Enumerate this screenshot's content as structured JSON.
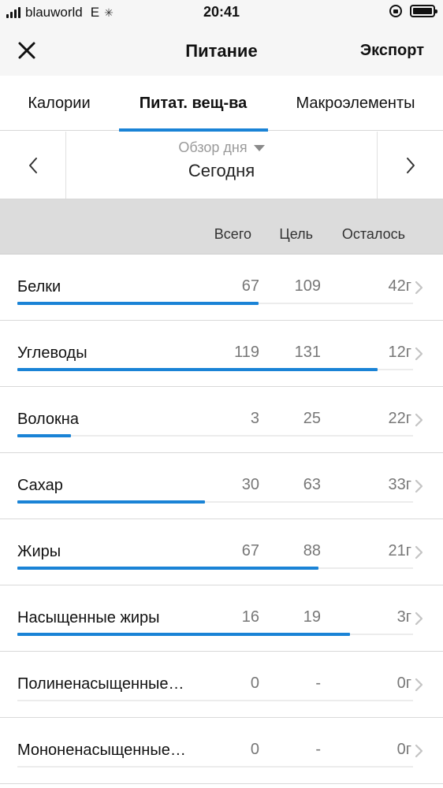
{
  "status_bar": {
    "carrier": "blauworld",
    "network": "E",
    "time": "20:41"
  },
  "nav": {
    "title": "Питание",
    "export_label": "Экспорт"
  },
  "tabs": [
    {
      "label": "Калории",
      "active": false
    },
    {
      "label": "Питат. вещ-ва",
      "active": true
    },
    {
      "label": "Макроэлементы",
      "active": false
    }
  ],
  "date_nav": {
    "view_label": "Обзор дня",
    "date": "Сегодня"
  },
  "columns": {
    "total": "Всего",
    "goal": "Цель",
    "remaining": "Осталось"
  },
  "colors": {
    "accent": "#1a83d6",
    "track": "#ececec",
    "header_bg": "#dcdcdc"
  },
  "nutrients": [
    {
      "name": "Белки",
      "total": "67",
      "goal": "109",
      "remaining": "42г",
      "progress": 0.61
    },
    {
      "name": "Углеводы",
      "total": "119",
      "goal": "131",
      "remaining": "12г",
      "progress": 0.91
    },
    {
      "name": "Волокна",
      "total": "3",
      "goal": "25",
      "remaining": "22г",
      "progress": 0.135
    },
    {
      "name": "Сахар",
      "total": "30",
      "goal": "63",
      "remaining": "33г",
      "progress": 0.475
    },
    {
      "name": "Жиры",
      "total": "67",
      "goal": "88",
      "remaining": "21г",
      "progress": 0.76
    },
    {
      "name": "Насыщенные жиры",
      "total": "16",
      "goal": "19",
      "remaining": "3г",
      "progress": 0.84
    },
    {
      "name": "Полиненасыщенные…",
      "total": "0",
      "goal": "-",
      "remaining": "0г",
      "progress": 0
    },
    {
      "name": "Мононенасыщенные…",
      "total": "0",
      "goal": "-",
      "remaining": "0г",
      "progress": 0
    }
  ]
}
